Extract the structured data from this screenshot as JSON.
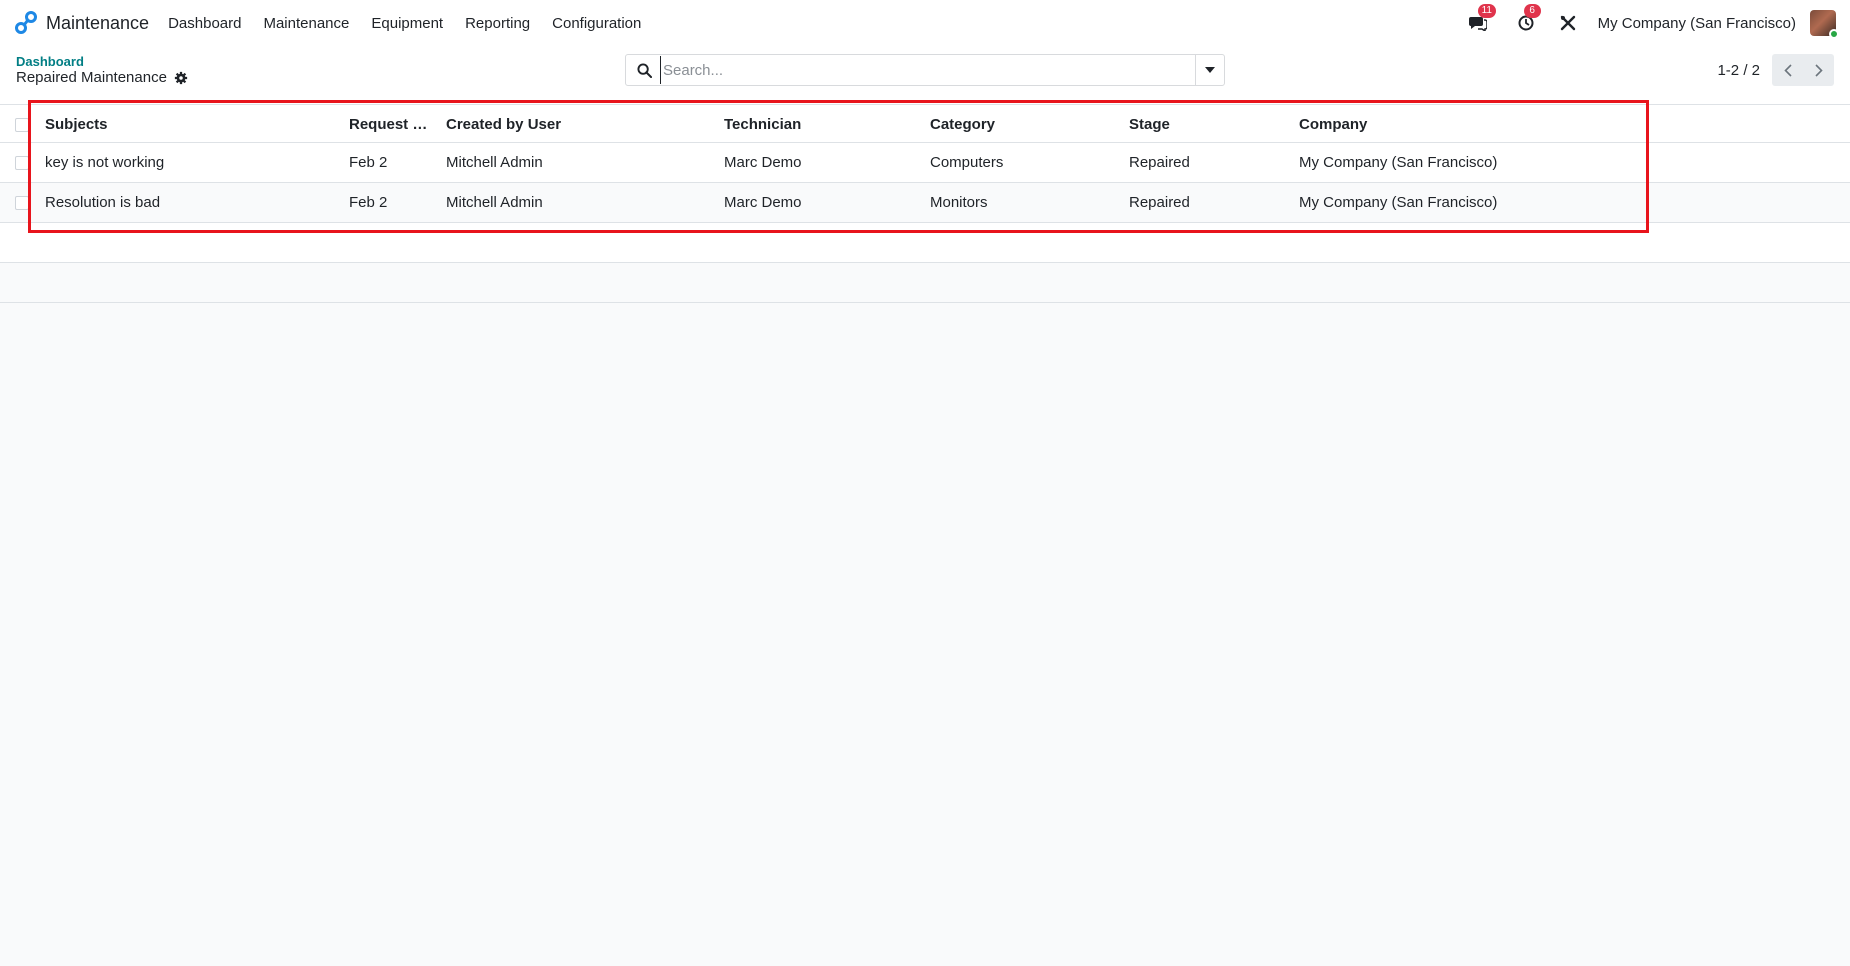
{
  "app": {
    "name": "Maintenance"
  },
  "menu": [
    {
      "label": "Dashboard"
    },
    {
      "label": "Maintenance"
    },
    {
      "label": "Equipment"
    },
    {
      "label": "Reporting"
    },
    {
      "label": "Configuration"
    }
  ],
  "systray": {
    "messages_badge": "11",
    "activities_badge": "6",
    "company": "My Company (San Francisco)"
  },
  "breadcrumb": {
    "parent": "Dashboard",
    "current": "Repaired Maintenance"
  },
  "search": {
    "placeholder": "Search...",
    "value": ""
  },
  "pager": {
    "value": "1-2 / 2"
  },
  "table": {
    "headers": {
      "subject": "Subjects",
      "request_date": "Request D...",
      "created_by": "Created by User",
      "technician": "Technician",
      "category": "Category",
      "stage": "Stage",
      "company": "Company"
    },
    "rows": [
      {
        "subject": "key is not working",
        "request_date": "Feb 2",
        "created_by": "Mitchell Admin",
        "technician": "Marc Demo",
        "category": "Computers",
        "stage": "Repaired",
        "company": "My Company (San Francisco)"
      },
      {
        "subject": "Resolution is bad",
        "request_date": "Feb 2",
        "created_by": "Mitchell Admin",
        "technician": "Marc Demo",
        "category": "Monitors",
        "stage": "Repaired",
        "company": "My Company (San Francisco)"
      }
    ]
  },
  "colors": {
    "brand": "#017e84",
    "badge": "#e0344c",
    "highlight": "#e8141c"
  }
}
